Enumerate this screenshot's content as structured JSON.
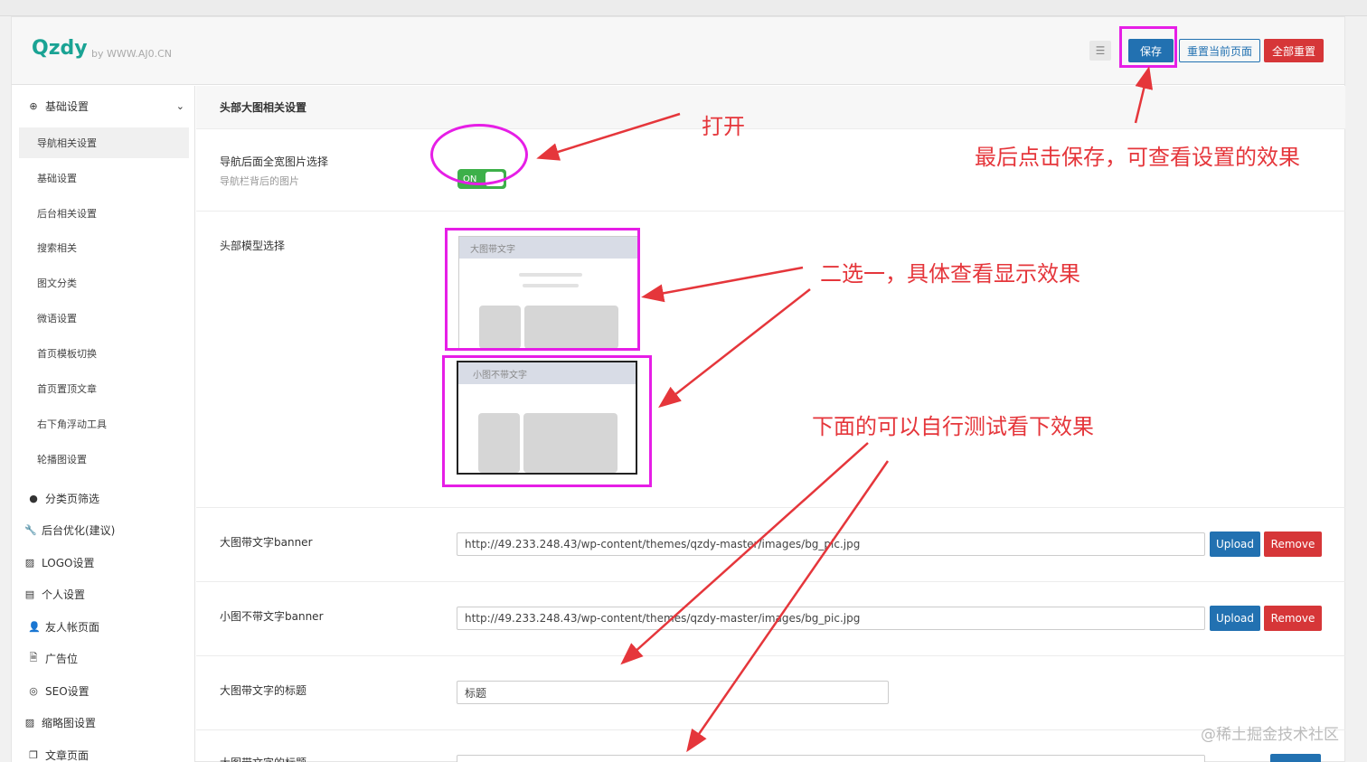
{
  "header": {
    "logo": "Qzdy",
    "logo_by": "by WWW.AJ0.CN",
    "menu_icon": "list-icon",
    "save_label": "保存",
    "reset_page_label": "重置当前页面",
    "reset_all_label": "全部重置"
  },
  "sidebar": {
    "group_basic": "基础设置",
    "items": [
      "导航相关设置",
      "基础设置",
      "后台相关设置",
      "搜索相关",
      "图文分类",
      "微语设置",
      "首页模板切换",
      "首页置顶文章",
      "右下角浮动工具",
      "轮播图设置"
    ],
    "sections": [
      "分类页筛选",
      "后台优化(建议)",
      "LOGO设置",
      "个人设置",
      "友人帐页面",
      "广告位",
      "SEO设置",
      "缩略图设置",
      "文章页面"
    ]
  },
  "content": {
    "section_title": "头部大图相关设置",
    "nav_bg_label": "导航后面全宽图片选择",
    "nav_bg_desc": "导航栏背后的图片",
    "toggle_label": "ON",
    "header_model_label": "头部模型选择",
    "thumb_big": "大图带文字",
    "thumb_small": "小图不带文字",
    "big_banner_label": "大图带文字banner",
    "big_banner_url": "http://49.233.248.43/wp-content/themes/qzdy-master/images/bg_pic.jpg",
    "small_banner_label": "小图不带文字banner",
    "small_banner_url": "http://49.233.248.43/wp-content/themes/qzdy-master/images/bg_pic.jpg",
    "upload_label": "Upload",
    "remove_label": "Remove",
    "big_title_label": "大图带文字的标题",
    "big_title_value": "标题",
    "partial_label": "大图带文字的标题"
  },
  "annotations": {
    "open": "打开",
    "save_hint": "最后点击保存，可查看设置的效果",
    "choose_one": "二选一，具体查看显示效果",
    "test_below": "下面的可以自行测试看下效果"
  },
  "watermark": "@稀土掘金技术社区",
  "colors": {
    "accent": "#2271b1",
    "danger": "#d63638",
    "toggle_on": "#3db049",
    "annotation": "#e5363b",
    "highlight": "#e61ee6",
    "logo": "#1aa394"
  }
}
